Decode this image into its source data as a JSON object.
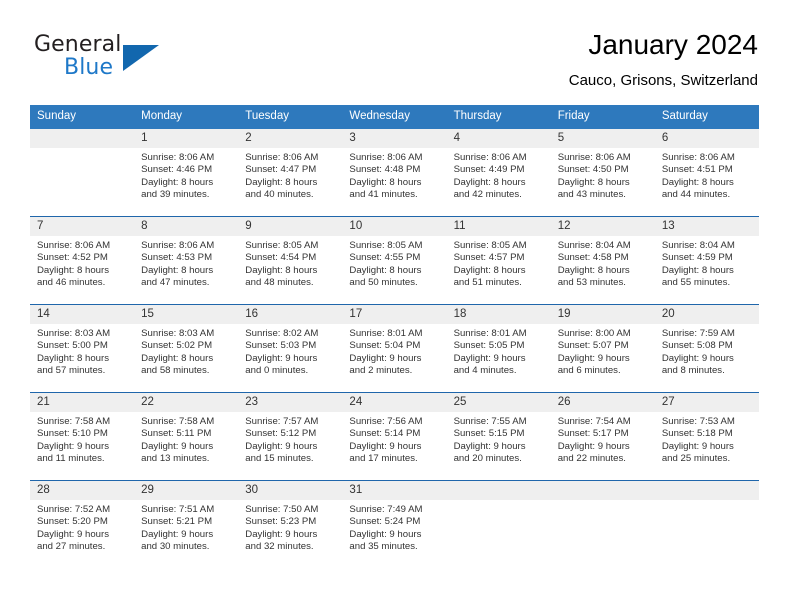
{
  "brand": {
    "name_part1": "General",
    "name_part2": "Blue",
    "triangle_color": "#1267ae",
    "blue_color": "#1e78c8"
  },
  "header": {
    "title": "January 2024",
    "subtitle": "Cauco, Grisons, Switzerland"
  },
  "theme": {
    "header_bg": "#2e79bd",
    "week_divider": "#1f66ab",
    "daynum_band": "#efefef"
  },
  "calendar": {
    "weekday_headers": [
      "Sunday",
      "Monday",
      "Tuesday",
      "Wednesday",
      "Thursday",
      "Friday",
      "Saturday"
    ],
    "weeks": [
      [
        {
          "day": "",
          "lines": []
        },
        {
          "day": "1",
          "lines": [
            "Sunrise: 8:06 AM",
            "Sunset: 4:46 PM",
            "Daylight: 8 hours",
            "and 39 minutes."
          ]
        },
        {
          "day": "2",
          "lines": [
            "Sunrise: 8:06 AM",
            "Sunset: 4:47 PM",
            "Daylight: 8 hours",
            "and 40 minutes."
          ]
        },
        {
          "day": "3",
          "lines": [
            "Sunrise: 8:06 AM",
            "Sunset: 4:48 PM",
            "Daylight: 8 hours",
            "and 41 minutes."
          ]
        },
        {
          "day": "4",
          "lines": [
            "Sunrise: 8:06 AM",
            "Sunset: 4:49 PM",
            "Daylight: 8 hours",
            "and 42 minutes."
          ]
        },
        {
          "day": "5",
          "lines": [
            "Sunrise: 8:06 AM",
            "Sunset: 4:50 PM",
            "Daylight: 8 hours",
            "and 43 minutes."
          ]
        },
        {
          "day": "6",
          "lines": [
            "Sunrise: 8:06 AM",
            "Sunset: 4:51 PM",
            "Daylight: 8 hours",
            "and 44 minutes."
          ]
        }
      ],
      [
        {
          "day": "7",
          "lines": [
            "Sunrise: 8:06 AM",
            "Sunset: 4:52 PM",
            "Daylight: 8 hours",
            "and 46 minutes."
          ]
        },
        {
          "day": "8",
          "lines": [
            "Sunrise: 8:06 AM",
            "Sunset: 4:53 PM",
            "Daylight: 8 hours",
            "and 47 minutes."
          ]
        },
        {
          "day": "9",
          "lines": [
            "Sunrise: 8:05 AM",
            "Sunset: 4:54 PM",
            "Daylight: 8 hours",
            "and 48 minutes."
          ]
        },
        {
          "day": "10",
          "lines": [
            "Sunrise: 8:05 AM",
            "Sunset: 4:55 PM",
            "Daylight: 8 hours",
            "and 50 minutes."
          ]
        },
        {
          "day": "11",
          "lines": [
            "Sunrise: 8:05 AM",
            "Sunset: 4:57 PM",
            "Daylight: 8 hours",
            "and 51 minutes."
          ]
        },
        {
          "day": "12",
          "lines": [
            "Sunrise: 8:04 AM",
            "Sunset: 4:58 PM",
            "Daylight: 8 hours",
            "and 53 minutes."
          ]
        },
        {
          "day": "13",
          "lines": [
            "Sunrise: 8:04 AM",
            "Sunset: 4:59 PM",
            "Daylight: 8 hours",
            "and 55 minutes."
          ]
        }
      ],
      [
        {
          "day": "14",
          "lines": [
            "Sunrise: 8:03 AM",
            "Sunset: 5:00 PM",
            "Daylight: 8 hours",
            "and 57 minutes."
          ]
        },
        {
          "day": "15",
          "lines": [
            "Sunrise: 8:03 AM",
            "Sunset: 5:02 PM",
            "Daylight: 8 hours",
            "and 58 minutes."
          ]
        },
        {
          "day": "16",
          "lines": [
            "Sunrise: 8:02 AM",
            "Sunset: 5:03 PM",
            "Daylight: 9 hours",
            "and 0 minutes."
          ]
        },
        {
          "day": "17",
          "lines": [
            "Sunrise: 8:01 AM",
            "Sunset: 5:04 PM",
            "Daylight: 9 hours",
            "and 2 minutes."
          ]
        },
        {
          "day": "18",
          "lines": [
            "Sunrise: 8:01 AM",
            "Sunset: 5:05 PM",
            "Daylight: 9 hours",
            "and 4 minutes."
          ]
        },
        {
          "day": "19",
          "lines": [
            "Sunrise: 8:00 AM",
            "Sunset: 5:07 PM",
            "Daylight: 9 hours",
            "and 6 minutes."
          ]
        },
        {
          "day": "20",
          "lines": [
            "Sunrise: 7:59 AM",
            "Sunset: 5:08 PM",
            "Daylight: 9 hours",
            "and 8 minutes."
          ]
        }
      ],
      [
        {
          "day": "21",
          "lines": [
            "Sunrise: 7:58 AM",
            "Sunset: 5:10 PM",
            "Daylight: 9 hours",
            "and 11 minutes."
          ]
        },
        {
          "day": "22",
          "lines": [
            "Sunrise: 7:58 AM",
            "Sunset: 5:11 PM",
            "Daylight: 9 hours",
            "and 13 minutes."
          ]
        },
        {
          "day": "23",
          "lines": [
            "Sunrise: 7:57 AM",
            "Sunset: 5:12 PM",
            "Daylight: 9 hours",
            "and 15 minutes."
          ]
        },
        {
          "day": "24",
          "lines": [
            "Sunrise: 7:56 AM",
            "Sunset: 5:14 PM",
            "Daylight: 9 hours",
            "and 17 minutes."
          ]
        },
        {
          "day": "25",
          "lines": [
            "Sunrise: 7:55 AM",
            "Sunset: 5:15 PM",
            "Daylight: 9 hours",
            "and 20 minutes."
          ]
        },
        {
          "day": "26",
          "lines": [
            "Sunrise: 7:54 AM",
            "Sunset: 5:17 PM",
            "Daylight: 9 hours",
            "and 22 minutes."
          ]
        },
        {
          "day": "27",
          "lines": [
            "Sunrise: 7:53 AM",
            "Sunset: 5:18 PM",
            "Daylight: 9 hours",
            "and 25 minutes."
          ]
        }
      ],
      [
        {
          "day": "28",
          "lines": [
            "Sunrise: 7:52 AM",
            "Sunset: 5:20 PM",
            "Daylight: 9 hours",
            "and 27 minutes."
          ]
        },
        {
          "day": "29",
          "lines": [
            "Sunrise: 7:51 AM",
            "Sunset: 5:21 PM",
            "Daylight: 9 hours",
            "and 30 minutes."
          ]
        },
        {
          "day": "30",
          "lines": [
            "Sunrise: 7:50 AM",
            "Sunset: 5:23 PM",
            "Daylight: 9 hours",
            "and 32 minutes."
          ]
        },
        {
          "day": "31",
          "lines": [
            "Sunrise: 7:49 AM",
            "Sunset: 5:24 PM",
            "Daylight: 9 hours",
            "and 35 minutes."
          ]
        },
        {
          "day": "",
          "lines": []
        },
        {
          "day": "",
          "lines": []
        },
        {
          "day": "",
          "lines": []
        }
      ]
    ]
  }
}
